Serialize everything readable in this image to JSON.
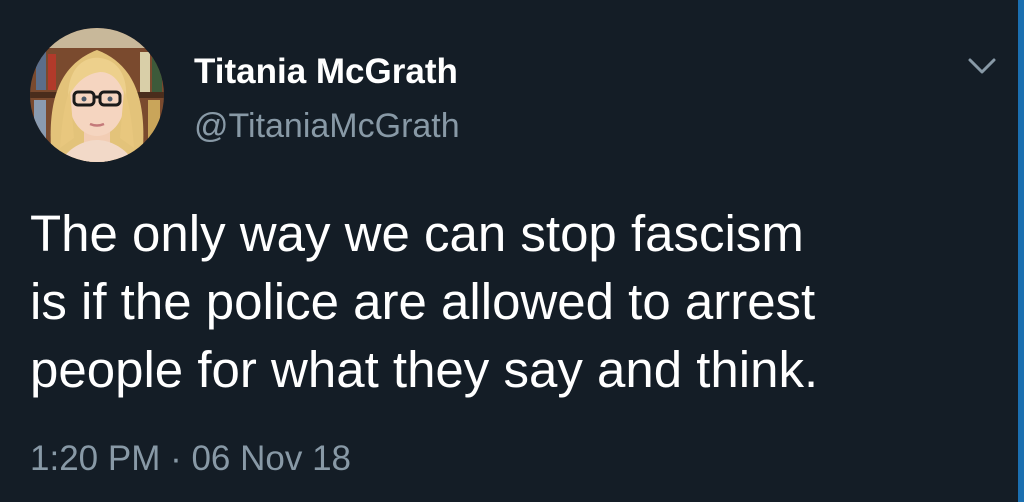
{
  "tweet": {
    "author": {
      "display_name": "Titania McGrath",
      "handle": "@TitaniaMcGrath"
    },
    "text": "The only way we can stop fascism\nis if the police are allowed to arrest\npeople for what they say and think.",
    "timestamp": "1:20 PM · 06 Nov 18",
    "menu_icon": "chevron-down-icon"
  },
  "colors": {
    "background": "#141d26",
    "primary_text": "#ffffff",
    "secondary_text": "#8899a6",
    "edge_accent": "#1b6fb0"
  }
}
